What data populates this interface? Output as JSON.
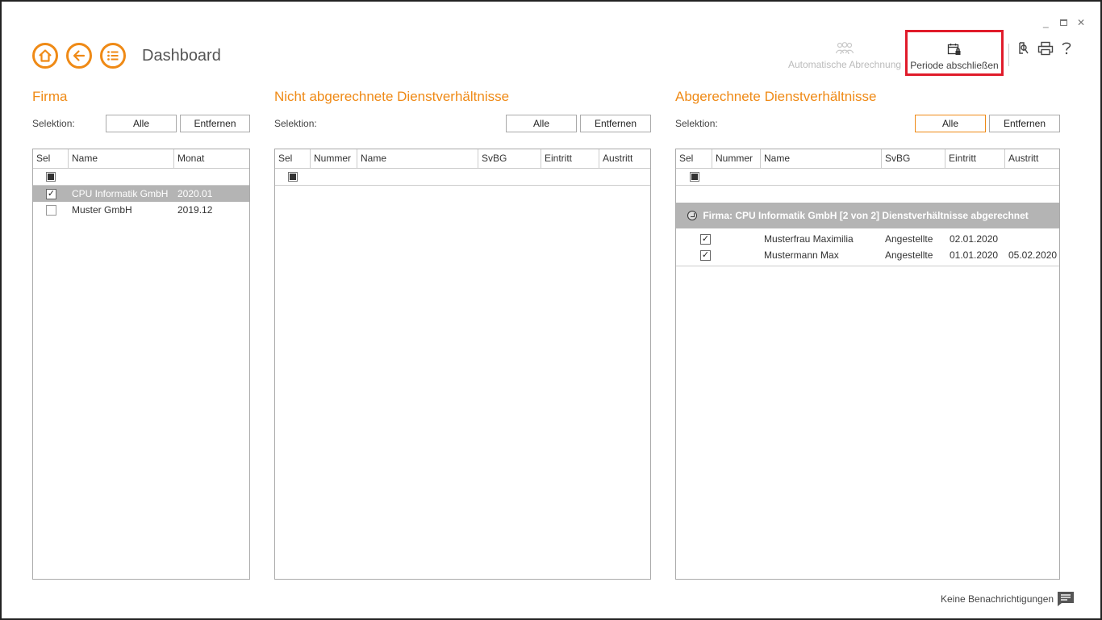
{
  "window": {
    "minimize": "_",
    "close": "✕"
  },
  "nav": {
    "title": "Dashboard"
  },
  "toolbar": {
    "auto_label": "Automatische Abrechnung",
    "periode_label": "Periode abschließen"
  },
  "firma": {
    "title": "Firma",
    "selektion": "Selektion:",
    "btn_alle": "Alle",
    "btn_entfernen": "Entfernen",
    "columns": [
      "Sel",
      "Name",
      "Monat"
    ],
    "rows": [
      {
        "checked": true,
        "name": "CPU Informatik GmbH",
        "monat": "2020.01"
      },
      {
        "checked": false,
        "name": "Muster GmbH",
        "monat": "2019.12"
      }
    ]
  },
  "nicht": {
    "title": "Nicht abgerechnete Dienstverhältnisse",
    "selektion": "Selektion:",
    "btn_alle": "Alle",
    "btn_entfernen": "Entfernen",
    "columns": [
      "Sel",
      "Nummer",
      "Name",
      "SvBG",
      "Eintritt",
      "Austritt"
    ]
  },
  "abger": {
    "title": "Abgerechnete Dienstverhältnisse",
    "selektion": "Selektion:",
    "btn_alle": "Alle",
    "btn_entfernen": "Entfernen",
    "columns": [
      "Sel",
      "Nummer",
      "Name",
      "SvBG",
      "Eintritt",
      "Austritt"
    ],
    "group": "Firma:  CPU Informatik GmbH [2 von 2] Dienstverhältnisse abgerechnet",
    "rows": [
      {
        "checked": true,
        "name": "Musterfrau Maximilia",
        "svbg": "Angestellte",
        "eintritt": "02.01.2020",
        "austritt": ""
      },
      {
        "checked": true,
        "name": "Mustermann Max",
        "svbg": "Angestellte",
        "eintritt": "01.01.2020",
        "austritt": "05.02.2020"
      }
    ]
  },
  "footer": {
    "notifications": "Keine Benachrichtigungen"
  },
  "colors": {
    "accent": "#ef8a16",
    "highlight": "#e01b2a",
    "selected_row": "#b4b4b4"
  },
  "check_glyph": "✓"
}
